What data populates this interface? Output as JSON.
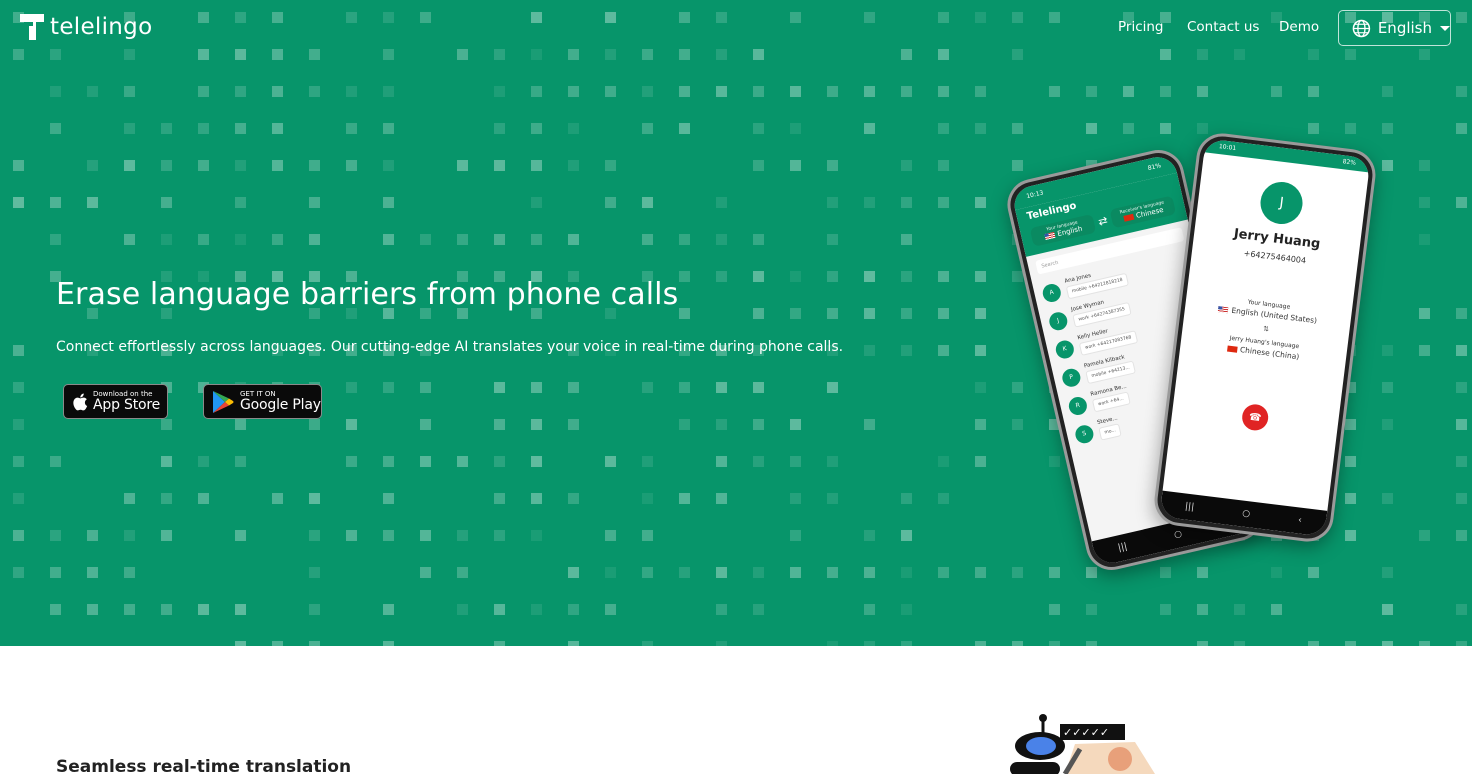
{
  "brand": {
    "name": "telelingo",
    "primary_color": "#07956a"
  },
  "nav": {
    "links": [
      {
        "label": "Pricing"
      },
      {
        "label": "Contact us"
      },
      {
        "label": "Demo"
      }
    ],
    "language_selector": {
      "icon": "globe-icon",
      "selected": "English"
    }
  },
  "hero": {
    "headline": "Erase language barriers from phone calls",
    "subheadline": "Connect effortlessly across languages. Our cutting-edge AI translates your voice in real-time during phone calls.",
    "store_buttons": [
      {
        "name": "app-store",
        "small": "Download on the",
        "big": "App Store"
      },
      {
        "name": "google-play",
        "small": "GET IT ON",
        "big": "Google Play"
      }
    ]
  },
  "phone_contacts": {
    "status_time": "10:13",
    "battery": "81%",
    "app_title": "Telelingo",
    "your_language_label": "Your language",
    "your_language": "English",
    "receiver_language_label": "Receiver's language",
    "receiver_language": "Chinese",
    "search_placeholder": "Search",
    "contacts": [
      {
        "initial": "A",
        "name": "Ana Jones",
        "number": "mobile +64212818218"
      },
      {
        "initial": "J",
        "name": "Jose Wyman",
        "number": "work +64274387355"
      },
      {
        "initial": "K",
        "name": "Kelly Heller",
        "number": "work +64217083768"
      },
      {
        "initial": "P",
        "name": "Pamela Kilback",
        "number": "mobile +64213..."
      },
      {
        "initial": "R",
        "name": "Ramona Be...",
        "number": "work +64..."
      },
      {
        "initial": "S",
        "name": "Steve...",
        "number": "mo..."
      }
    ]
  },
  "phone_call": {
    "status_time": "10:01",
    "battery": "82%",
    "avatar_initial": "J",
    "caller_name": "Jerry Huang",
    "caller_number": "+64275464004",
    "your_language_label": "Your language",
    "your_language": "English (United States)",
    "separator": "⇅",
    "their_language_label": "Jerry Huang's language",
    "their_language": "Chinese (China)"
  },
  "section": {
    "title": "Seamless real-time translation"
  }
}
